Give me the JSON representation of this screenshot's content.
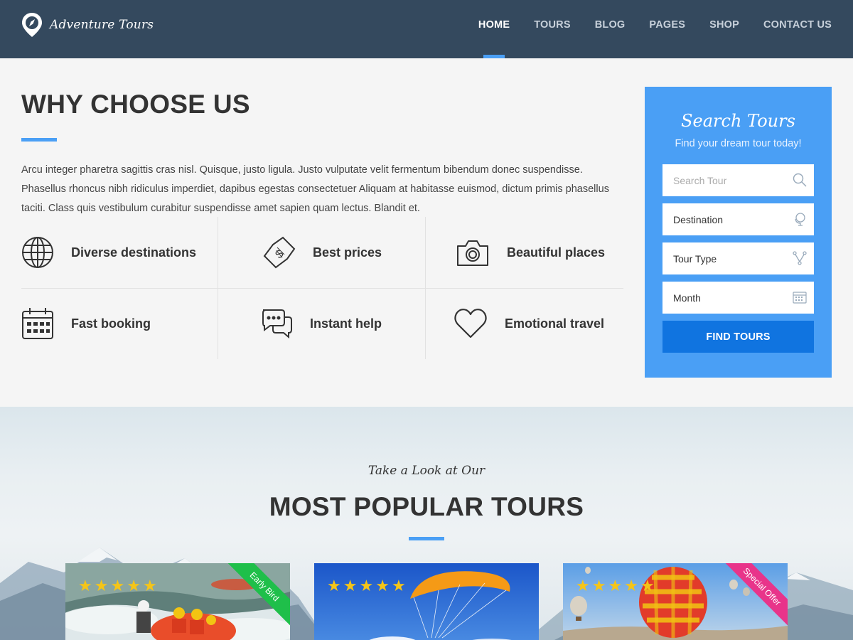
{
  "header": {
    "logo_text": "Adventure Tours",
    "nav": [
      {
        "label": "HOME",
        "active": true
      },
      {
        "label": "TOURS"
      },
      {
        "label": "BLOG"
      },
      {
        "label": "PAGES"
      },
      {
        "label": "SHOP"
      },
      {
        "label": "CONTACT US"
      }
    ]
  },
  "why": {
    "title": "WHY CHOOSE US",
    "text": "Arcu integer pharetra sagittis cras nisl. Quisque, justo ligula. Justo vulputate velit fermentum bibendum donec suspendisse. Phasellus rhoncus nibh ridiculus imperdiet, dapibus egestas consectetuer Aliquam at habitasse euismod, dictum primis phasellus taciti. Class quis vestibulum curabitur suspendisse amet sapien quam lectus. Blandit et.",
    "features": [
      {
        "label": "Diverse destinations",
        "icon": "globe-icon"
      },
      {
        "label": "Best prices",
        "icon": "price-tag-icon"
      },
      {
        "label": "Beautiful places",
        "icon": "camera-icon"
      },
      {
        "label": "Fast booking",
        "icon": "calendar-icon"
      },
      {
        "label": "Instant help",
        "icon": "chat-icon"
      },
      {
        "label": "Emotional travel",
        "icon": "heart-icon"
      }
    ]
  },
  "search": {
    "title": "Search Tours",
    "subtitle": "Find your dream tour today!",
    "search_placeholder": "Search Tour",
    "destination": "Destination",
    "tour_type": "Tour Type",
    "month": "Month",
    "button": "FIND TOURS"
  },
  "popular": {
    "subtitle": "Take a Look at Our",
    "title": "MOST POPULAR TOURS",
    "cards": [
      {
        "name": "rafting",
        "rating": 5,
        "ribbon": "Early Bird",
        "ribbon_color": "#1fbf4a"
      },
      {
        "name": "paragliding",
        "rating": 5,
        "ribbon": ""
      },
      {
        "name": "hot-air-balloon",
        "rating": 5,
        "ribbon": "Special Offer",
        "ribbon_color": "#e8348a"
      }
    ]
  },
  "colors": {
    "header_bg": "#34495e",
    "accent": "#4a9ff5",
    "button": "#1074e0"
  }
}
